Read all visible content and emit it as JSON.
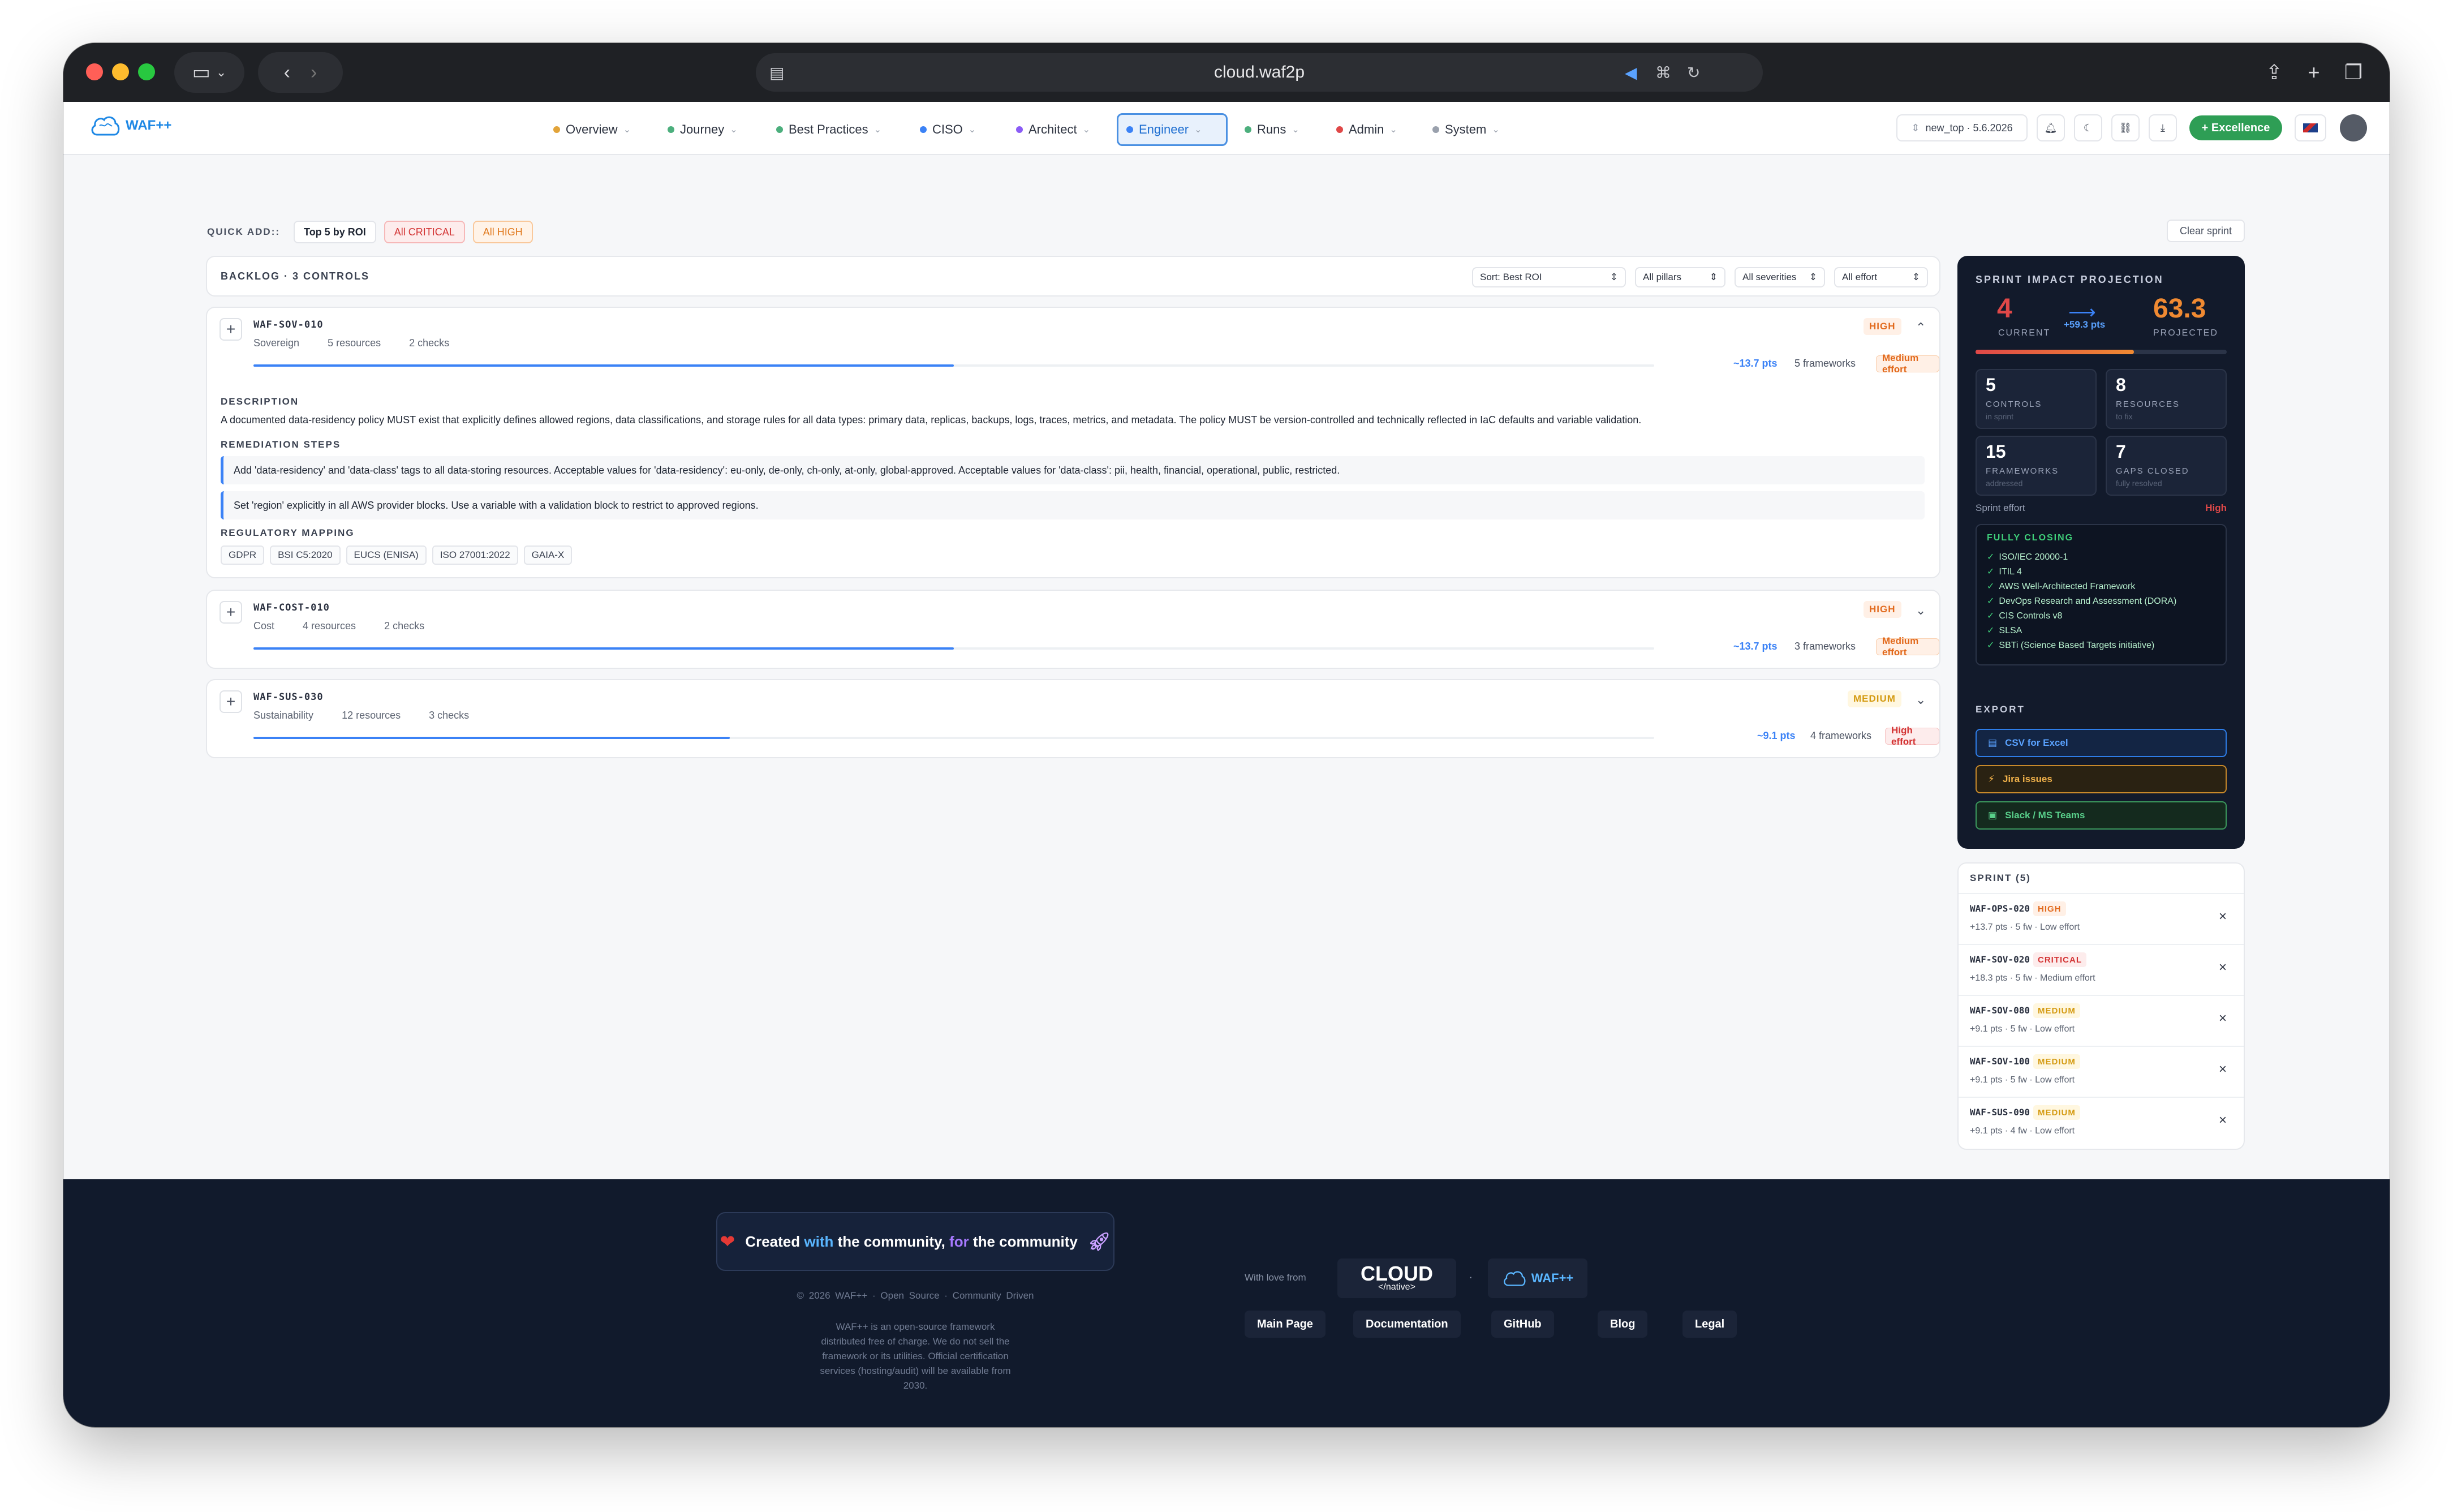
{
  "browser": {
    "url": "cloud.waf2p"
  },
  "nav": {
    "logo_text": "WAF++",
    "items": [
      {
        "label": "Overview",
        "dot": "#e2a43a"
      },
      {
        "label": "Journey",
        "dot": "#4caf7d"
      },
      {
        "label": "Best Practices",
        "dot": "#4caf7d"
      },
      {
        "label": "CISO",
        "dot": "#3b82f6"
      },
      {
        "label": "Architect",
        "dot": "#8b5cf6"
      },
      {
        "label": "Engineer",
        "dot": "#3b82f6"
      },
      {
        "label": "Runs",
        "dot": "#4caf7d"
      },
      {
        "label": "Admin",
        "dot": "#e04848"
      },
      {
        "label": "System",
        "dot": "#9aa1ad"
      }
    ],
    "active": "Engineer",
    "version_label": "new_top · 5.6.2026",
    "excellence_label": "+ Excellence"
  },
  "quick_add": {
    "label": "QUICK ADD::",
    "top5": "Top 5 by ROI",
    "critical": "All CRITICAL",
    "high": "All HIGH",
    "clear": "Clear sprint"
  },
  "backlog": {
    "title": "BACKLOG · 3 CONTROLS",
    "sort": "Sort: Best ROI",
    "pillars": "All pillars",
    "severities": "All severities",
    "effort": "All effort",
    "cards": [
      {
        "id": "WAF-SOV-010",
        "pillar": "Sovereign",
        "resources": "5 resources",
        "checks": "2 checks",
        "severity": "HIGH",
        "progress": 0.5,
        "pts": "~13.7 pts",
        "frameworks": "5 frameworks",
        "effort": "Medium effort",
        "description_label": "DESCRIPTION",
        "description": "A documented data-residency policy MUST exist that explicitly defines allowed regions, data classifications, and storage rules for all data types: primary data, replicas, backups, logs, traces, metrics, and metadata. The policy MUST be version-controlled and technically reflected in IaC defaults and variable validation.",
        "remediation_label": "REMEDIATION STEPS",
        "steps": [
          "Add 'data-residency' and 'data-class' tags to all data-storing resources. Acceptable values for 'data-residency': eu-only, de-only, ch-only, at-only, global-approved. Acceptable values for 'data-class': pii, health, financial, operational, public, restricted.",
          "Set 'region' explicitly in all AWS provider blocks. Use a variable with a validation block to restrict to approved regions."
        ],
        "regulatory_label": "REGULATORY MAPPING",
        "regulatory": [
          "GDPR",
          "BSI C5:2020",
          "EUCS (ENISA)",
          "ISO 27001:2022",
          "GAIA-X"
        ]
      },
      {
        "id": "WAF-COST-010",
        "pillar": "Cost",
        "resources": "4 resources",
        "checks": "2 checks",
        "severity": "HIGH",
        "progress": 0.5,
        "pts": "~13.7 pts",
        "frameworks": "3 frameworks",
        "effort": "Medium effort"
      },
      {
        "id": "WAF-SUS-030",
        "pillar": "Sustainability",
        "resources": "12 resources",
        "checks": "3 checks",
        "severity": "MEDIUM",
        "progress": 0.34,
        "pts": "~9.1 pts",
        "frameworks": "4 frameworks",
        "effort": "High effort"
      }
    ]
  },
  "impact": {
    "title": "SPRINT IMPACT PROJECTION",
    "current": "4",
    "current_label": "CURRENT",
    "delta": "+59.3 pts",
    "projected": "63.3",
    "projected_label": "PROJECTED",
    "progress": 0.63,
    "stats": [
      {
        "value": "5",
        "label": "CONTROLS",
        "sub": "in sprint"
      },
      {
        "value": "8",
        "label": "RESOURCES",
        "sub": "to fix"
      },
      {
        "value": "15",
        "label": "FRAMEWORKS",
        "sub": "addressed"
      },
      {
        "value": "7",
        "label": "GAPS CLOSED",
        "sub": "fully resolved"
      }
    ],
    "effort_label": "Sprint effort",
    "effort_value": "High",
    "closing_label": "FULLY CLOSING",
    "closing": [
      "ISO/IEC 20000-1",
      "ITIL 4",
      "AWS Well-Architected Framework",
      "DevOps Research and Assessment (DORA)",
      "CIS Controls v8",
      "SLSA",
      "SBTi (Science Based Targets initiative)"
    ],
    "export_label": "EXPORT",
    "export_csv": "CSV for Excel",
    "export_jira": "Jira issues",
    "export_slack": "Slack / MS Teams"
  },
  "sprint": {
    "title": "SPRINT (5)",
    "items": [
      {
        "id": "WAF-OPS-020",
        "severity": "HIGH",
        "sub": "+13.7 pts · 5 fw · Low effort"
      },
      {
        "id": "WAF-SOV-020",
        "severity": "CRITICAL",
        "sub": "+18.3 pts · 5 fw · Medium effort"
      },
      {
        "id": "WAF-SOV-080",
        "severity": "MEDIUM",
        "sub": "+9.1 pts · 5 fw · Low effort"
      },
      {
        "id": "WAF-SOV-100",
        "severity": "MEDIUM",
        "sub": "+9.1 pts · 5 fw · Low effort"
      },
      {
        "id": "WAF-SUS-090",
        "severity": "MEDIUM",
        "sub": "+9.1 pts · 4 fw · Low effort"
      }
    ]
  },
  "footer": {
    "created_a": "Created ",
    "created_with": "with",
    "created_b": " the community, ",
    "created_for": "for",
    "created_c": " the community",
    "copyright": "© 2026 WAF++ · Open Source · Community Driven",
    "note": "WAF++ is an open-source framework distributed free of charge. We do not sell the framework or its utilities. Official certification services (hosting/audit) will be available from 2030.",
    "with_love": "With love from",
    "cloud_logo": "CLOUD",
    "cloud_logo_sub": "</native>",
    "waf_logo": "WAF++",
    "links": [
      "Main Page",
      "Documentation",
      "GitHub",
      "Blog",
      "Legal"
    ]
  }
}
